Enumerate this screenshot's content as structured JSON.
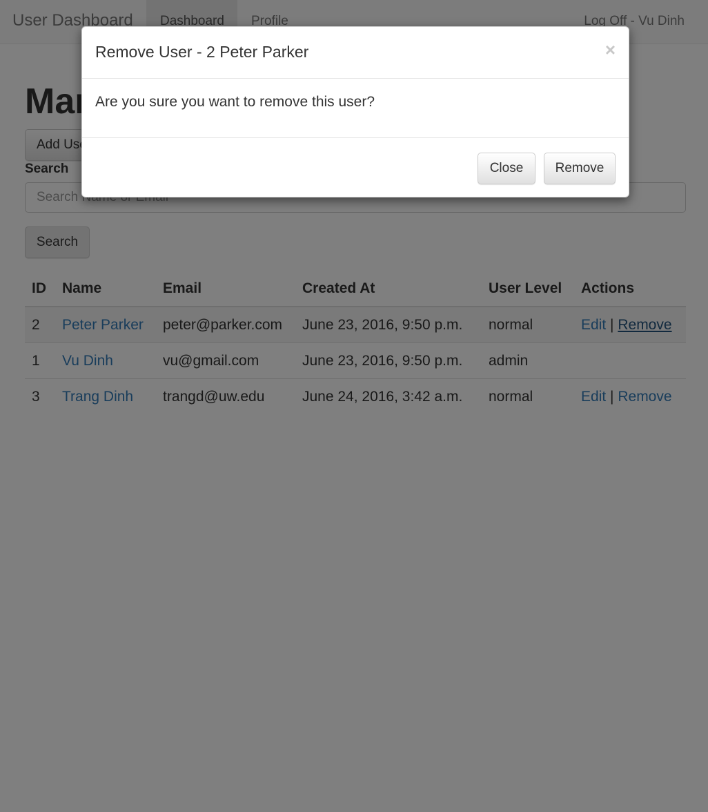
{
  "navbar": {
    "brand": "User Dashboard",
    "links": [
      {
        "label": "Dashboard",
        "active": true
      },
      {
        "label": "Profile",
        "active": false
      }
    ],
    "logoff": "Log Off - Vu Dinh"
  },
  "page": {
    "title": "Manage Users",
    "add_button": "Add User",
    "search_label": "Search",
    "search_placeholder": "Search Name or Email",
    "search_button": "Search"
  },
  "table": {
    "headers": [
      "ID",
      "Name",
      "Email",
      "Created At",
      "User Level",
      "Actions"
    ],
    "rows": [
      {
        "id": "2",
        "name": "Peter Parker",
        "email": "peter@parker.com",
        "created": "June 23, 2016, 9:50 p.m.",
        "level": "normal",
        "edit": "Edit",
        "sep": "|",
        "remove": "Remove"
      },
      {
        "id": "1",
        "name": "Vu Dinh",
        "email": "vu@gmail.com",
        "created": "June 23, 2016, 9:50 p.m.",
        "level": "admin"
      },
      {
        "id": "3",
        "name": "Trang Dinh",
        "email": "trangd@uw.edu",
        "created": "June 24, 2016, 3:42 a.m.",
        "level": "normal",
        "edit": "Edit",
        "sep": "|",
        "remove": "Remove"
      }
    ]
  },
  "modal": {
    "title": "Remove User - 2 Peter Parker",
    "close_glyph": "×",
    "body": "Are you sure you want to remove this user?",
    "close_button": "Close",
    "remove_button": "Remove"
  },
  "colors": {
    "link": "#337ab7",
    "backdrop": "rgba(0,0,0,0.5)"
  }
}
